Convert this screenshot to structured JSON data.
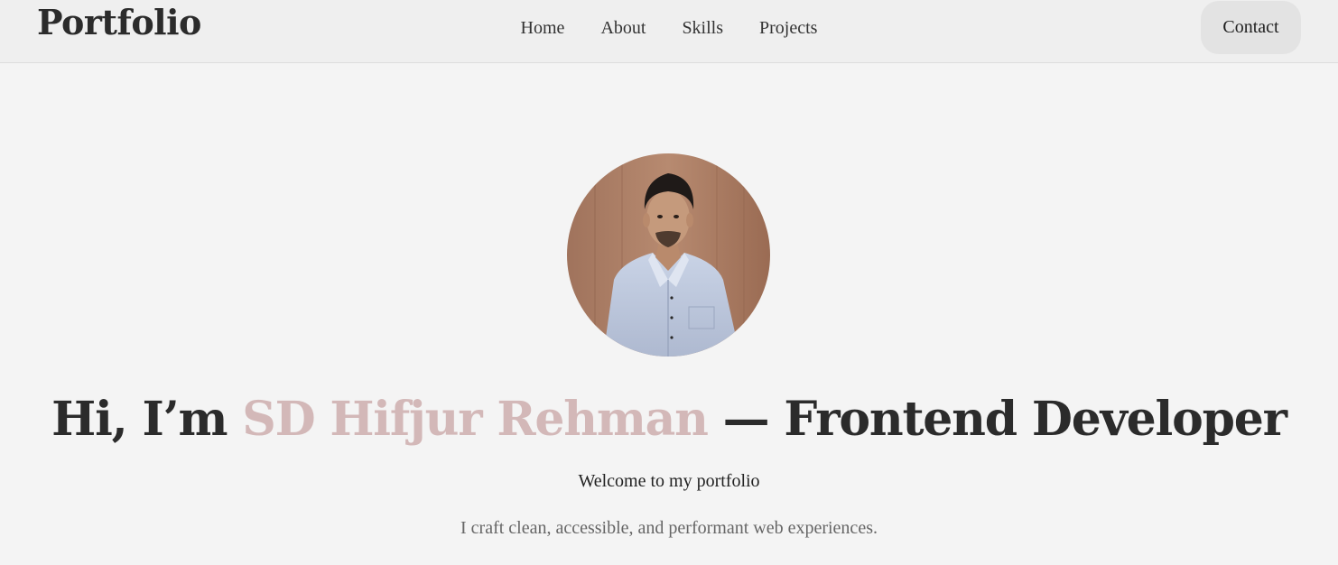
{
  "nav": {
    "brand": "Portfolio",
    "links": [
      "Home",
      "About",
      "Skills",
      "Projects"
    ],
    "contact_label": "Contact"
  },
  "hero": {
    "headline_prefix": "Hi, I’m ",
    "headline_name": "SD Hifjur Rehman",
    "headline_suffix": " — Frontend Developer",
    "welcome": "Welcome to my portfolio",
    "tagline": "I craft clean, accessible, and performant web experiences."
  },
  "colors": {
    "background": "#f4f4f4",
    "navbar": "#efefef",
    "accent_name": "#d3b8b8",
    "text": "#2b2b2b",
    "muted_text": "#666666",
    "contact_button": "#e3e3e3"
  }
}
